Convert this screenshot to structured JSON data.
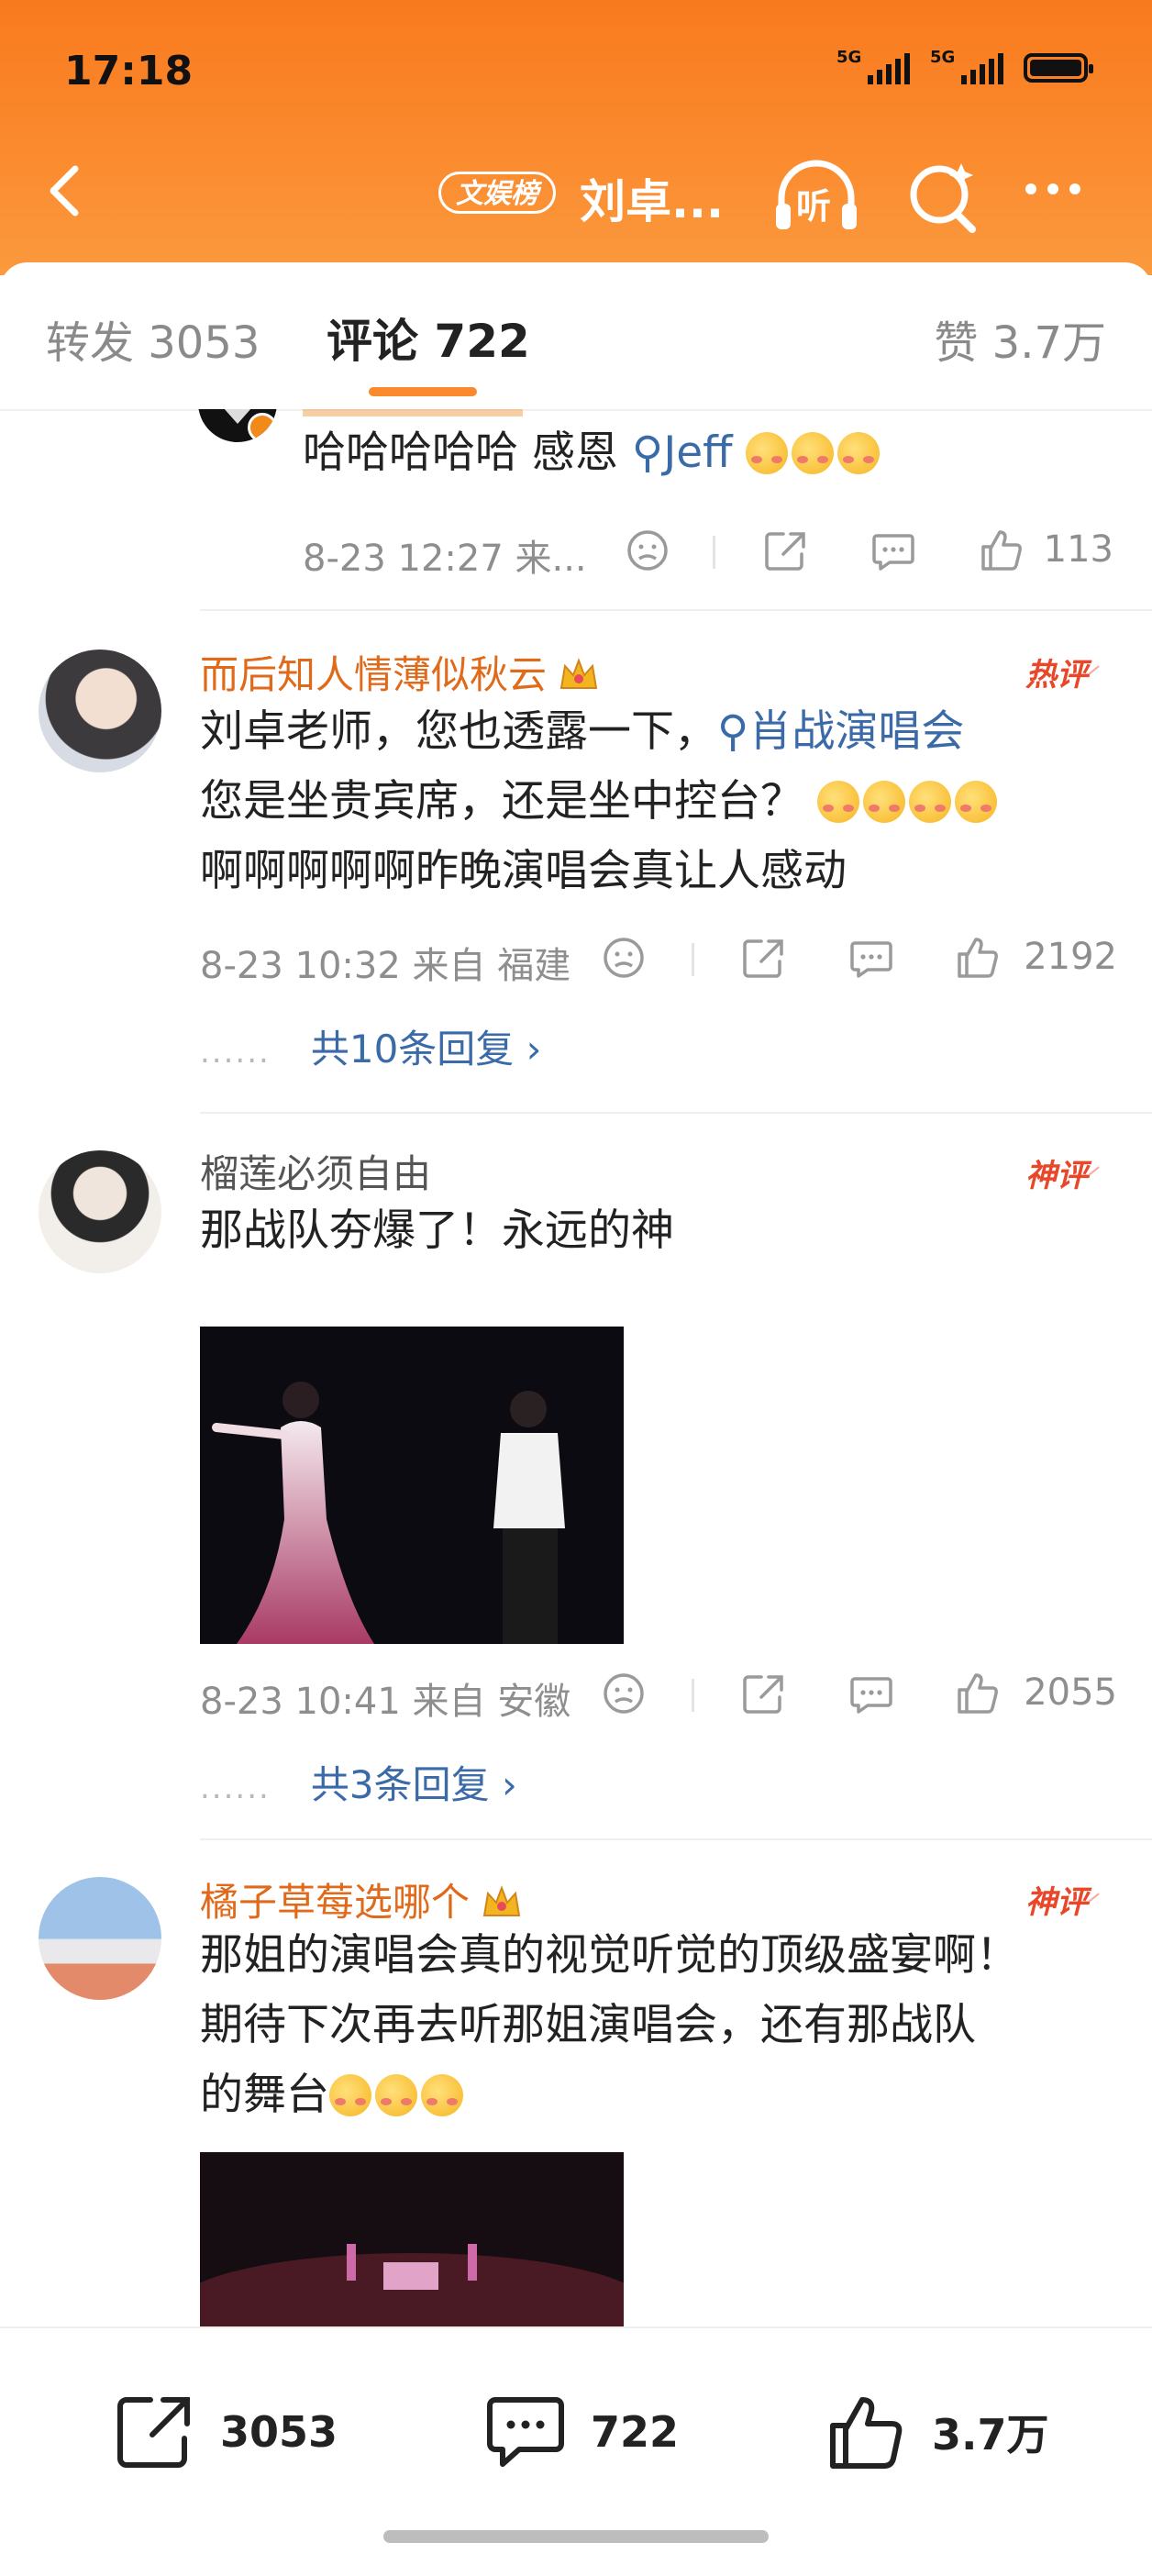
{
  "status": {
    "time": "17:18",
    "network1": "5G",
    "network2": "5G"
  },
  "nav": {
    "badge": "文娱榜",
    "title": "刘卓...",
    "listen_label": "听"
  },
  "tabs": {
    "forward": "转发 3053",
    "comments": "评论 722",
    "likes": "赞 3.7万"
  },
  "comments": [
    {
      "text_plain": "哈哈哈哈哈 感恩 ",
      "link": "Jeff",
      "time": "8-23 12:27",
      "source": "来...",
      "likes": "113"
    },
    {
      "username": "而后知人情薄似秋云",
      "badge": "热评",
      "text_line1_plain": "刘卓老师，您也透露一下，",
      "text_line1_link": "肖战演唱会",
      "text_line2": "您是坐贵宾席，还是坐中控台？",
      "text_line3": "啊啊啊啊啊昨晚演唱会真让人感动",
      "time": "8-23 10:32",
      "source": "来自 福建",
      "likes": "2192",
      "replies_dots": "......",
      "replies": "共10条回复"
    },
    {
      "username": "榴莲必须自由",
      "badge": "神评",
      "text": "那战队夯爆了！永远的神",
      "time": "8-23 10:41",
      "source": "来自 安徽",
      "likes": "2055",
      "replies_dots": "......",
      "replies": "共3条回复"
    },
    {
      "username": "橘子草莓选哪个",
      "badge": "神评",
      "text_line1": "那姐的演唱会真的视觉听觉的顶级盛宴啊！",
      "text_line2": "期待下次再去听那姐演唱会，还有那战队",
      "text_line3": "的舞台"
    }
  ],
  "bottom": {
    "forward_count": "3053",
    "comment_count": "722",
    "like_count": "3.7万"
  },
  "colors": {
    "header_orange": "#f97a1e",
    "link_blue": "#3a6aa8",
    "username_orange": "#e06a1a",
    "badge_red": "#e8472a"
  },
  "icons": [
    "back-icon",
    "listen-icon",
    "search-icon",
    "more-icon",
    "dislike-icon",
    "share-icon",
    "comment-icon",
    "like-icon",
    "crown-icon"
  ]
}
